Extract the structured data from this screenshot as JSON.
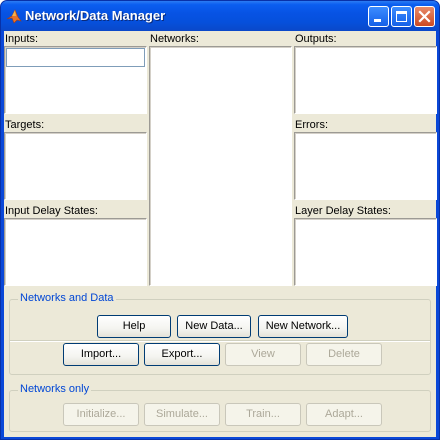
{
  "window": {
    "title": "Network/Data Manager",
    "icon": "matlab-logo-icon",
    "controls": [
      "minimize-icon",
      "maximize-icon",
      "close-icon"
    ]
  },
  "panels": {
    "inputs_label": "Inputs:",
    "targets_label": "Targets:",
    "input_delay_states_label": "Input Delay States:",
    "networks_label": "Networks:",
    "outputs_label": "Outputs:",
    "errors_label": "Errors:",
    "layer_delay_states_label": "Layer Delay States:"
  },
  "networks_and_data": {
    "title": "Networks and Data",
    "help_label": "Help",
    "new_data_label": "New Data...",
    "new_network_label": "New Network...",
    "import_label": "Import...",
    "export_label": "Export...",
    "view_label": "View",
    "delete_label": "Delete"
  },
  "networks_only": {
    "title": "Networks only",
    "initialize_label": "Initialize...",
    "simulate_label": "Simulate...",
    "train_label": "Train...",
    "adapt_label": "Adapt..."
  },
  "colors": {
    "titlebar": "#0650dc",
    "client": "#ece9d8",
    "group_title": "#0046d5",
    "disabled_text": "#aca899"
  }
}
